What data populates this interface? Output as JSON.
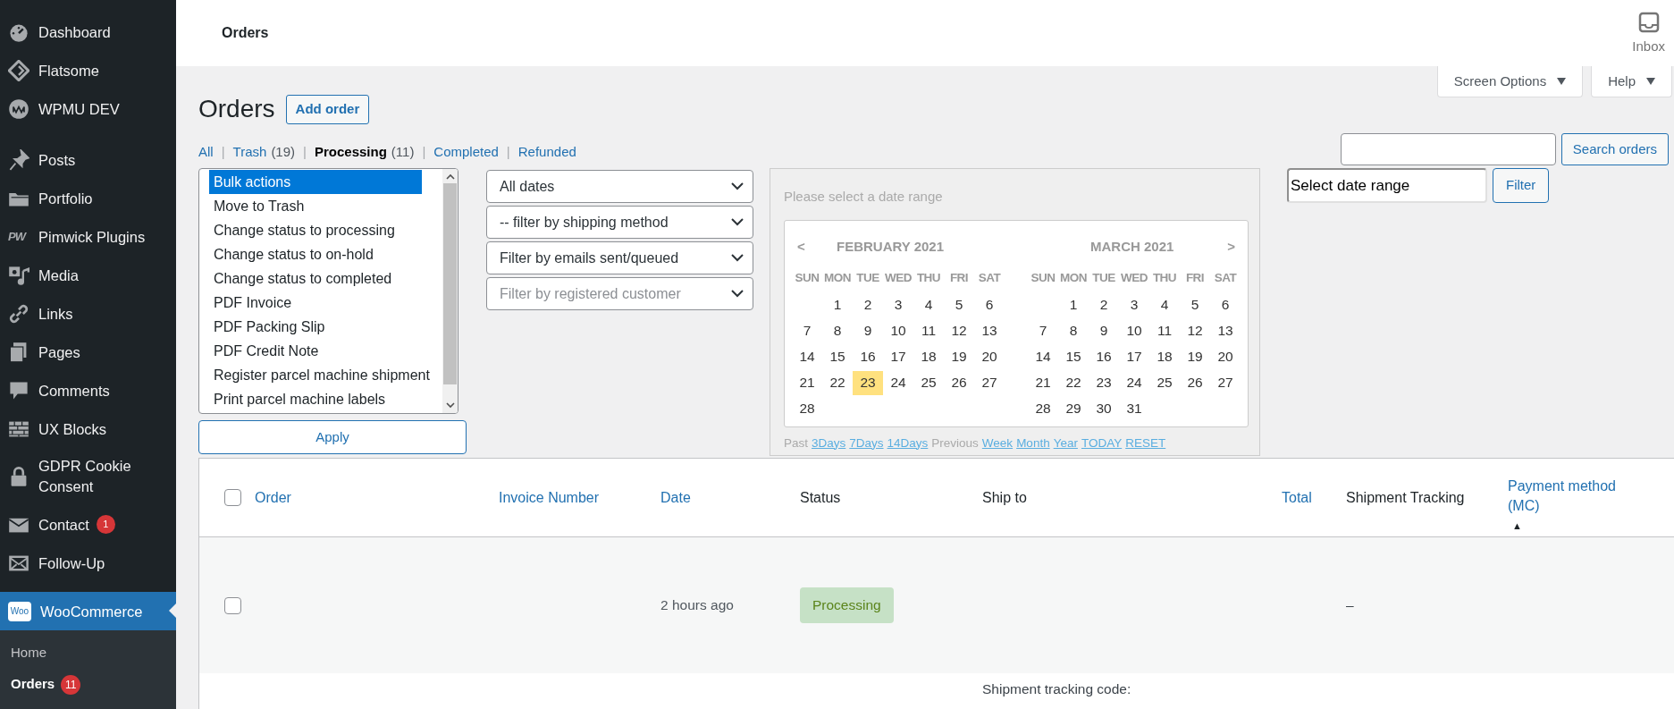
{
  "sidebar": {
    "sections": [
      {
        "items": [
          {
            "label": "Dashboard",
            "selected": false
          },
          {
            "label": "Flatsome",
            "selected": false
          },
          {
            "label": "WPMU DEV",
            "selected": false
          }
        ]
      },
      {
        "items": [
          {
            "label": "Posts",
            "selected": false
          },
          {
            "label": "Portfolio",
            "selected": false
          },
          {
            "label": "Pimwick Plugins",
            "icon_text": "PW",
            "selected": false
          },
          {
            "label": "Media",
            "selected": false
          },
          {
            "label": "Links",
            "selected": false
          },
          {
            "label": "Pages",
            "selected": false
          },
          {
            "label": "Comments",
            "selected": false
          },
          {
            "label": "UX Blocks",
            "selected": false
          },
          {
            "label": "GDPR Cookie Consent",
            "selected": false
          },
          {
            "label": "Contact",
            "badge": "1",
            "selected": false
          },
          {
            "label": "Follow-Up",
            "selected": false
          }
        ]
      },
      {
        "items": [
          {
            "label": "WooCommerce",
            "icon_text": "Woo",
            "selected": true,
            "children": [
              {
                "label": "Home",
                "selected": false
              },
              {
                "label": "Orders",
                "badge": "11",
                "selected": true
              }
            ]
          }
        ]
      }
    ]
  },
  "header": {
    "title": "Orders",
    "inbox": "Inbox"
  },
  "help_tabs": [
    "Screen Options",
    "Help"
  ],
  "page": {
    "title": "Orders",
    "add_button": "Add order"
  },
  "status_links": [
    {
      "label": "All",
      "selected": false
    },
    {
      "separator": "|",
      "label": "Trash",
      "count": "(19)",
      "selected": false
    },
    {
      "separator": "|",
      "label": "Processing",
      "count": "(11)",
      "selected": true
    },
    {
      "separator": "|",
      "label": "Completed",
      "selected": false
    },
    {
      "separator": "|",
      "label": "Refunded",
      "selected": false
    }
  ],
  "search": {
    "button": "Search orders"
  },
  "bulk_actions": {
    "options": [
      {
        "label": "Bulk actions",
        "selected": true
      },
      {
        "label": "Move to Trash",
        "selected": false
      },
      {
        "label": "Change status to processing",
        "selected": false
      },
      {
        "label": "Change status to on-hold",
        "selected": false
      },
      {
        "label": "Change status to completed",
        "selected": false
      },
      {
        "label": "PDF Invoice",
        "selected": false
      },
      {
        "label": "PDF Packing Slip",
        "selected": false
      },
      {
        "label": "PDF Credit Note",
        "selected": false
      },
      {
        "label": "Register parcel machine shipment",
        "selected": false
      },
      {
        "label": "Print parcel machine labels",
        "selected": false
      }
    ],
    "apply": "Apply"
  },
  "filters": [
    {
      "value": "All dates"
    },
    {
      "value": "-- filter by shipping method"
    },
    {
      "value": "Filter by emails sent/queued"
    },
    {
      "placeholder": "Filter by registered customer"
    }
  ],
  "date_picker": {
    "prompt": "Please select a date range",
    "prev": "<",
    "next": ">",
    "months": [
      {
        "title": "FEBRUARY 2021",
        "weekdays": [
          "SUN",
          "MON",
          "TUE",
          "WED",
          "THU",
          "FRI",
          "SAT"
        ],
        "weeks": [
          [
            {
              "day": "1",
              "selected": false
            },
            {
              "day": "2",
              "selected": false
            },
            {
              "day": "3",
              "selected": false
            },
            {
              "day": "4",
              "selected": false
            },
            {
              "day": "5",
              "selected": false
            },
            {
              "day": "6",
              "selected": false
            }
          ],
          [
            {
              "day": "7",
              "selected": false
            },
            {
              "day": "8",
              "selected": false
            },
            {
              "day": "9",
              "selected": false
            },
            {
              "day": "10",
              "selected": false
            },
            {
              "day": "11",
              "selected": false
            },
            {
              "day": "12",
              "selected": false
            },
            {
              "day": "13",
              "selected": false
            }
          ],
          [
            {
              "day": "14",
              "selected": false
            },
            {
              "day": "15",
              "selected": false
            },
            {
              "day": "16",
              "selected": false
            },
            {
              "day": "17",
              "selected": false
            },
            {
              "day": "18",
              "selected": false
            },
            {
              "day": "19",
              "selected": false
            },
            {
              "day": "20",
              "selected": false
            }
          ],
          [
            {
              "day": "21",
              "selected": false
            },
            {
              "day": "22",
              "selected": false
            },
            {
              "day": "23",
              "selected": true
            },
            {
              "day": "24",
              "selected": false
            },
            {
              "day": "25",
              "selected": false
            },
            {
              "day": "26",
              "selected": false
            },
            {
              "day": "27",
              "selected": false
            }
          ],
          [
            {
              "day": "28",
              "selected": false
            }
          ]
        ]
      },
      {
        "title": "MARCH 2021",
        "weekdays": [
          "SUN",
          "MON",
          "TUE",
          "WED",
          "THU",
          "FRI",
          "SAT"
        ],
        "weeks": [
          [
            {
              "day": "1",
              "selected": false
            },
            {
              "day": "2",
              "selected": false
            },
            {
              "day": "3",
              "selected": false
            },
            {
              "day": "4",
              "selected": false
            },
            {
              "day": "5",
              "selected": false
            },
            {
              "day": "6",
              "selected": false
            }
          ],
          [
            {
              "day": "7",
              "selected": false
            },
            {
              "day": "8",
              "selected": false
            },
            {
              "day": "9",
              "selected": false
            },
            {
              "day": "10",
              "selected": false
            },
            {
              "day": "11",
              "selected": false
            },
            {
              "day": "12",
              "selected": false
            },
            {
              "day": "13",
              "selected": false
            }
          ],
          [
            {
              "day": "14",
              "selected": false
            },
            {
              "day": "15",
              "selected": false
            },
            {
              "day": "16",
              "selected": false
            },
            {
              "day": "17",
              "selected": false
            },
            {
              "day": "18",
              "selected": false
            },
            {
              "day": "19",
              "selected": false
            },
            {
              "day": "20",
              "selected": false
            }
          ],
          [
            {
              "day": "21",
              "selected": false
            },
            {
              "day": "22",
              "selected": false
            },
            {
              "day": "23",
              "selected": false
            },
            {
              "day": "24",
              "selected": false
            },
            {
              "day": "25",
              "selected": false
            },
            {
              "day": "26",
              "selected": false
            },
            {
              "day": "27",
              "selected": false
            }
          ],
          [
            {
              "day": "28",
              "selected": false
            },
            {
              "day": "29",
              "selected": false
            },
            {
              "day": "30",
              "selected": false
            },
            {
              "day": "31",
              "selected": false
            }
          ]
        ]
      }
    ],
    "shortcuts": [
      {
        "kind": "text",
        "label": "Past"
      },
      {
        "kind": "link",
        "label": "3Days"
      },
      {
        "kind": "link",
        "label": "7Days"
      },
      {
        "kind": "link",
        "label": "14Days"
      },
      {
        "kind": "text",
        "label": "Previous"
      },
      {
        "kind": "link",
        "label": "Week"
      },
      {
        "kind": "link",
        "label": "Month"
      },
      {
        "kind": "link",
        "label": "Year"
      },
      {
        "kind": "link",
        "label": "TODAY"
      },
      {
        "kind": "link",
        "label": "RESET"
      }
    ]
  },
  "date_range": {
    "value": "Select date range",
    "button": "Filter"
  },
  "table": {
    "select_all": {
      "checked": false
    },
    "columns": [
      {
        "label": "Order",
        "sortable": true
      },
      {
        "label": "Invoice Number",
        "sortable": true
      },
      {
        "label": "Date",
        "sortable": true
      },
      {
        "label": "Status",
        "sortable": false
      },
      {
        "label": "Ship to",
        "sortable": false
      },
      {
        "label": "Total",
        "sortable": true
      },
      {
        "label": "Shipment Tracking",
        "sortable": false
      },
      {
        "label": "Payment method (MC)",
        "sortable": true,
        "sort_indicator": "▲"
      }
    ],
    "rows": [
      {
        "checked": false,
        "date": "2 hours ago",
        "status": "Processing",
        "shipment_tracking": "–"
      },
      {
        "ship_to": "Shipment tracking code:"
      }
    ]
  }
}
